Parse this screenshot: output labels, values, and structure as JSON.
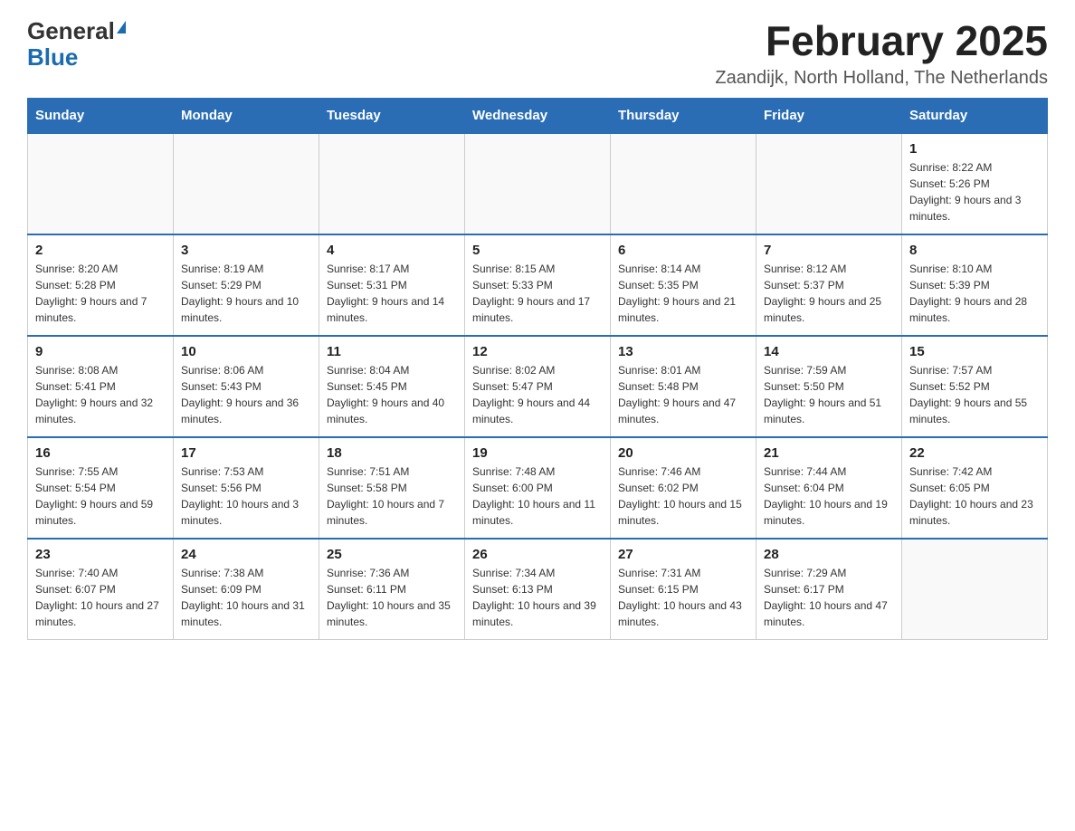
{
  "header": {
    "logo_general": "General",
    "logo_blue": "Blue",
    "month_title": "February 2025",
    "location": "Zaandijk, North Holland, The Netherlands"
  },
  "weekdays": [
    "Sunday",
    "Monday",
    "Tuesday",
    "Wednesday",
    "Thursday",
    "Friday",
    "Saturday"
  ],
  "weeks": [
    [
      {
        "day": "",
        "info": ""
      },
      {
        "day": "",
        "info": ""
      },
      {
        "day": "",
        "info": ""
      },
      {
        "day": "",
        "info": ""
      },
      {
        "day": "",
        "info": ""
      },
      {
        "day": "",
        "info": ""
      },
      {
        "day": "1",
        "info": "Sunrise: 8:22 AM\nSunset: 5:26 PM\nDaylight: 9 hours and 3 minutes."
      }
    ],
    [
      {
        "day": "2",
        "info": "Sunrise: 8:20 AM\nSunset: 5:28 PM\nDaylight: 9 hours and 7 minutes."
      },
      {
        "day": "3",
        "info": "Sunrise: 8:19 AM\nSunset: 5:29 PM\nDaylight: 9 hours and 10 minutes."
      },
      {
        "day": "4",
        "info": "Sunrise: 8:17 AM\nSunset: 5:31 PM\nDaylight: 9 hours and 14 minutes."
      },
      {
        "day": "5",
        "info": "Sunrise: 8:15 AM\nSunset: 5:33 PM\nDaylight: 9 hours and 17 minutes."
      },
      {
        "day": "6",
        "info": "Sunrise: 8:14 AM\nSunset: 5:35 PM\nDaylight: 9 hours and 21 minutes."
      },
      {
        "day": "7",
        "info": "Sunrise: 8:12 AM\nSunset: 5:37 PM\nDaylight: 9 hours and 25 minutes."
      },
      {
        "day": "8",
        "info": "Sunrise: 8:10 AM\nSunset: 5:39 PM\nDaylight: 9 hours and 28 minutes."
      }
    ],
    [
      {
        "day": "9",
        "info": "Sunrise: 8:08 AM\nSunset: 5:41 PM\nDaylight: 9 hours and 32 minutes."
      },
      {
        "day": "10",
        "info": "Sunrise: 8:06 AM\nSunset: 5:43 PM\nDaylight: 9 hours and 36 minutes."
      },
      {
        "day": "11",
        "info": "Sunrise: 8:04 AM\nSunset: 5:45 PM\nDaylight: 9 hours and 40 minutes."
      },
      {
        "day": "12",
        "info": "Sunrise: 8:02 AM\nSunset: 5:47 PM\nDaylight: 9 hours and 44 minutes."
      },
      {
        "day": "13",
        "info": "Sunrise: 8:01 AM\nSunset: 5:48 PM\nDaylight: 9 hours and 47 minutes."
      },
      {
        "day": "14",
        "info": "Sunrise: 7:59 AM\nSunset: 5:50 PM\nDaylight: 9 hours and 51 minutes."
      },
      {
        "day": "15",
        "info": "Sunrise: 7:57 AM\nSunset: 5:52 PM\nDaylight: 9 hours and 55 minutes."
      }
    ],
    [
      {
        "day": "16",
        "info": "Sunrise: 7:55 AM\nSunset: 5:54 PM\nDaylight: 9 hours and 59 minutes."
      },
      {
        "day": "17",
        "info": "Sunrise: 7:53 AM\nSunset: 5:56 PM\nDaylight: 10 hours and 3 minutes."
      },
      {
        "day": "18",
        "info": "Sunrise: 7:51 AM\nSunset: 5:58 PM\nDaylight: 10 hours and 7 minutes."
      },
      {
        "day": "19",
        "info": "Sunrise: 7:48 AM\nSunset: 6:00 PM\nDaylight: 10 hours and 11 minutes."
      },
      {
        "day": "20",
        "info": "Sunrise: 7:46 AM\nSunset: 6:02 PM\nDaylight: 10 hours and 15 minutes."
      },
      {
        "day": "21",
        "info": "Sunrise: 7:44 AM\nSunset: 6:04 PM\nDaylight: 10 hours and 19 minutes."
      },
      {
        "day": "22",
        "info": "Sunrise: 7:42 AM\nSunset: 6:05 PM\nDaylight: 10 hours and 23 minutes."
      }
    ],
    [
      {
        "day": "23",
        "info": "Sunrise: 7:40 AM\nSunset: 6:07 PM\nDaylight: 10 hours and 27 minutes."
      },
      {
        "day": "24",
        "info": "Sunrise: 7:38 AM\nSunset: 6:09 PM\nDaylight: 10 hours and 31 minutes."
      },
      {
        "day": "25",
        "info": "Sunrise: 7:36 AM\nSunset: 6:11 PM\nDaylight: 10 hours and 35 minutes."
      },
      {
        "day": "26",
        "info": "Sunrise: 7:34 AM\nSunset: 6:13 PM\nDaylight: 10 hours and 39 minutes."
      },
      {
        "day": "27",
        "info": "Sunrise: 7:31 AM\nSunset: 6:15 PM\nDaylight: 10 hours and 43 minutes."
      },
      {
        "day": "28",
        "info": "Sunrise: 7:29 AM\nSunset: 6:17 PM\nDaylight: 10 hours and 47 minutes."
      },
      {
        "day": "",
        "info": ""
      }
    ]
  ]
}
